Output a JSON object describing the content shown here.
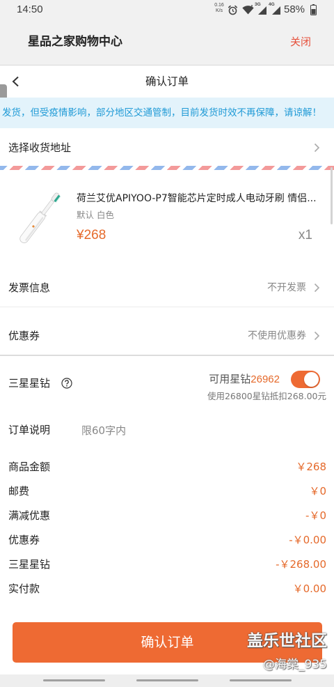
{
  "status_bar": {
    "time": "14:50",
    "net_speed_value": "0.16",
    "net_speed_unit": "K/s",
    "network_1_label": "3G",
    "network_2_label": "4G",
    "battery_percent": "58%",
    "alarm_icon": "alarm-icon",
    "wifi_icon": "wifi-icon",
    "signal_icon": "signal-icon",
    "battery_icon": "battery-icon"
  },
  "app_header": {
    "title": "星品之家购物中心",
    "close_label": "关闭"
  },
  "nav_bar": {
    "back_icon": "chevron-left-icon",
    "title": "确认订单"
  },
  "notice": {
    "text": "发货，但受疫情影响，部分地区交通管制，目前发货时效不再保障，请谅解！"
  },
  "address": {
    "label": "选择收货地址",
    "icon": "chevron-right-icon"
  },
  "product": {
    "image_icon": "electric-toothbrush-image",
    "title": "荷兰艾优APIYOO-P7智能芯片定时成人电动牙刷 情侣...",
    "spec": "默认 白色",
    "price": "¥268",
    "quantity": "x1"
  },
  "invoice": {
    "label": "发票信息",
    "value": "不开发票"
  },
  "coupon": {
    "label": "优惠券",
    "value": "不使用优惠券"
  },
  "star_diamond": {
    "label": "三星星钻",
    "help_icon": "question-circle-icon",
    "available_label": "可用星钻",
    "available_value": "26962",
    "toggle_on": true,
    "deduction_text": "使用26800星钻抵扣268.00元"
  },
  "order_note": {
    "label": "订单说明",
    "placeholder": "限60字内"
  },
  "summary": [
    {
      "label": "商品金额",
      "value": "￥268"
    },
    {
      "label": "邮费",
      "value": "￥0"
    },
    {
      "label": "满减优惠",
      "value": "-￥0"
    },
    {
      "label": "优惠券",
      "value": "-￥0.00"
    },
    {
      "label": "三星星钻",
      "value": "-￥268.00"
    },
    {
      "label": "实付款",
      "value": "￥0.00"
    }
  ],
  "confirm_button": {
    "label": "确认订单"
  },
  "watermark": {
    "brand": "盖乐世社区",
    "user": "@海棠_935"
  },
  "colors": {
    "accent": "#ee6a33",
    "price": "#e5692a",
    "close": "#e6503b",
    "notice_bg": "#e3f3fb",
    "notice_text": "#1f9ad6"
  }
}
